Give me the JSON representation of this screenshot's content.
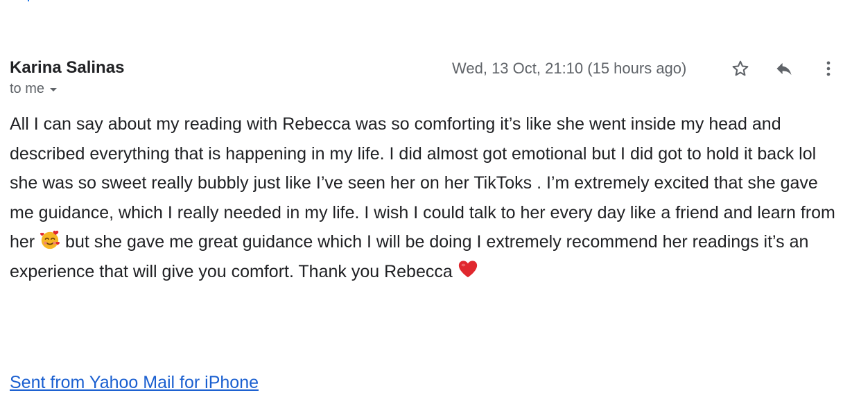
{
  "message": {
    "sender_name": "Karina Salinas",
    "recipient_label": "to me",
    "timestamp": "Wed, 13 Oct, 21:10 (15 hours ago)",
    "body_part1": "All I can say about my reading with Rebecca was so comforting it’s like she went inside my head and described everything that is happening in my life. I did almost got emotional but I did got to hold it back lol she was so sweet really bubbly just like I’ve seen her on her TikToks . I’m extremely excited that she gave me guidance, which I really needed in my life. I wish I could talk to her every day like a friend and learn from her ",
    "body_part2": " but she gave me great guidance which I will be doing I extremely recommend her readings it’s an experience that will give you comfort. Thank you Rebecca ",
    "signature_link": "Sent from Yahoo Mail for iPhone"
  },
  "icons": {
    "star": "star-outline-icon",
    "reply": "reply-arrow-icon",
    "more": "vertical-dots-icon",
    "recipient_caret": "caret-down-icon",
    "emoji_1": "smiling-face-with-hearts-emoji",
    "emoji_2": "red-heart-emoji"
  },
  "colors": {
    "text": "#202124",
    "secondary_text": "#5f6368",
    "link": "#1a5fd0",
    "heart": "#e0282e",
    "emoji_face": "#f6b624"
  }
}
